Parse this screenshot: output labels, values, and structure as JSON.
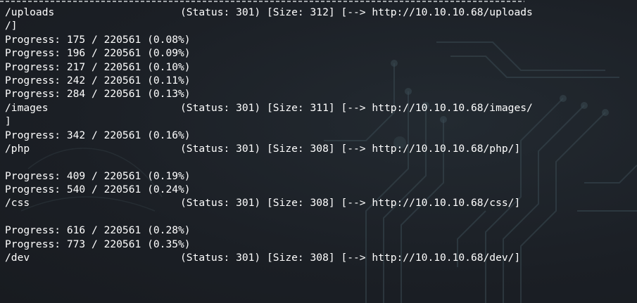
{
  "terminal": {
    "colors": {
      "background": "#1c2026",
      "text": "#ffffff",
      "art": "#3a4a52"
    },
    "lines": [
      {
        "kind": "result",
        "path": "/uploads",
        "info": "(Status: 301) [Size: 312] [--> http://10.10.10.68/uploads"
      },
      {
        "kind": "text",
        "text": "/]"
      },
      {
        "kind": "text",
        "text": "Progress: 175 / 220561 (0.08%)"
      },
      {
        "kind": "text",
        "text": "Progress: 196 / 220561 (0.09%)"
      },
      {
        "kind": "text",
        "text": "Progress: 217 / 220561 (0.10%)"
      },
      {
        "kind": "text",
        "text": "Progress: 242 / 220561 (0.11%)"
      },
      {
        "kind": "text",
        "text": "Progress: 284 / 220561 (0.13%)"
      },
      {
        "kind": "result",
        "path": "/images",
        "info": "(Status: 301) [Size: 311] [--> http://10.10.10.68/images/"
      },
      {
        "kind": "text",
        "text": "]"
      },
      {
        "kind": "text",
        "text": "Progress: 342 / 220561 (0.16%)"
      },
      {
        "kind": "result",
        "path": "/php",
        "info": "(Status: 301) [Size: 308] [--> http://10.10.10.68/php/]"
      },
      {
        "kind": "text",
        "text": ""
      },
      {
        "kind": "text",
        "text": "Progress: 409 / 220561 (0.19%)"
      },
      {
        "kind": "text",
        "text": "Progress: 540 / 220561 (0.24%)"
      },
      {
        "kind": "result",
        "path": "/css",
        "info": "(Status: 301) [Size: 308] [--> http://10.10.10.68/css/]"
      },
      {
        "kind": "text",
        "text": ""
      },
      {
        "kind": "text",
        "text": "Progress: 616 / 220561 (0.28%)"
      },
      {
        "kind": "text",
        "text": "Progress: 773 / 220561 (0.35%)"
      },
      {
        "kind": "result",
        "path": "/dev",
        "info": "(Status: 301) [Size: 308] [--> http://10.10.10.68/dev/]"
      }
    ]
  }
}
